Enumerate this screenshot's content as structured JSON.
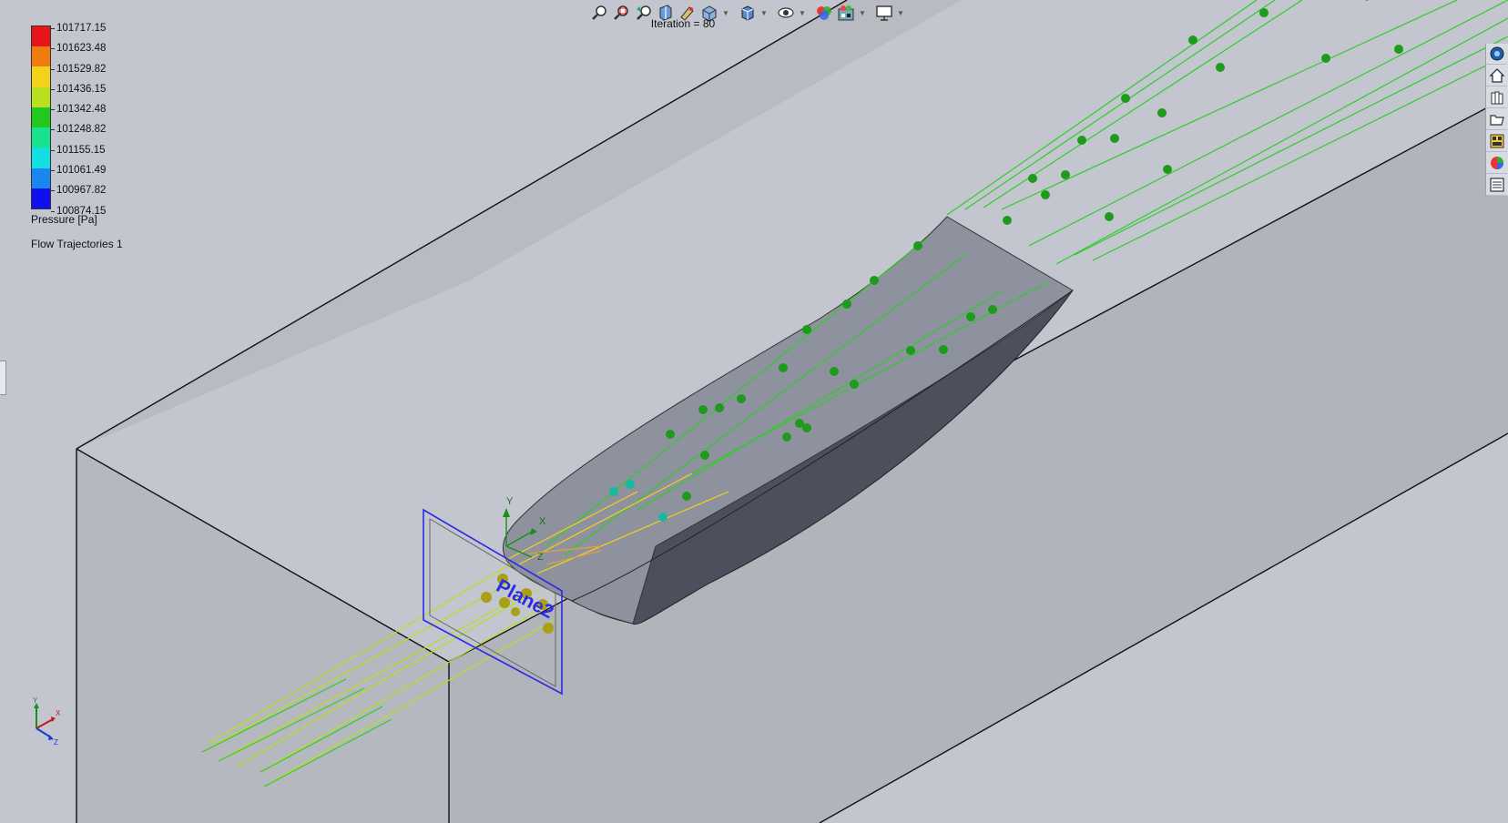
{
  "toolbar": {
    "buttons": [
      {
        "icon": "zoom-to-fit-icon",
        "has_dropdown": false
      },
      {
        "icon": "zoom-to-area-icon",
        "has_dropdown": false
      },
      {
        "icon": "previous-view-icon",
        "has_dropdown": false
      },
      {
        "icon": "section-view-icon",
        "has_dropdown": false
      },
      {
        "icon": "dynamic-annotation-icon",
        "has_dropdown": false
      },
      {
        "icon": "view-orientation-icon",
        "has_dropdown": true
      },
      {
        "icon": "display-style-icon",
        "has_dropdown": true
      },
      {
        "icon": "hide-show-items-icon",
        "has_dropdown": true
      },
      {
        "icon": "edit-appearance-icon",
        "has_dropdown": false
      },
      {
        "icon": "apply-scene-icon",
        "has_dropdown": true
      },
      {
        "icon": "view-settings-icon",
        "has_dropdown": true
      }
    ]
  },
  "iteration_label": "Iteration = 80",
  "legend": {
    "values": [
      "101717.15",
      "101623.48",
      "101529.82",
      "101436.15",
      "101342.48",
      "101248.82",
      "101155.15",
      "101061.49",
      "100967.82",
      "100874.15"
    ],
    "colors": [
      "#e8141a",
      "#f07c10",
      "#f2d21a",
      "#b8e01c",
      "#22c81e",
      "#18e28e",
      "#12e0e0",
      "#1888f0",
      "#1010ee"
    ],
    "title": "Pressure [Pa]",
    "subtitle": "Flow Trajectories 1"
  },
  "plane_label": "Plane2",
  "axis_labels": {
    "x": "X",
    "y": "Y",
    "z": "Z"
  },
  "task_pane": {
    "tabs": [
      {
        "icon": "solidworks-resources-icon"
      },
      {
        "icon": "home-icon"
      },
      {
        "icon": "design-library-icon"
      },
      {
        "icon": "file-explorer-icon"
      },
      {
        "icon": "view-palette-icon"
      },
      {
        "icon": "appearances-icon"
      },
      {
        "icon": "custom-properties-icon"
      }
    ]
  },
  "colors": {
    "background": "#c3c6ce",
    "domain_face": "#b3b5bc",
    "airfoil_top": "#8e929e",
    "airfoil_side": "#4c4f5c",
    "plane_border": "#2a2ae6"
  }
}
